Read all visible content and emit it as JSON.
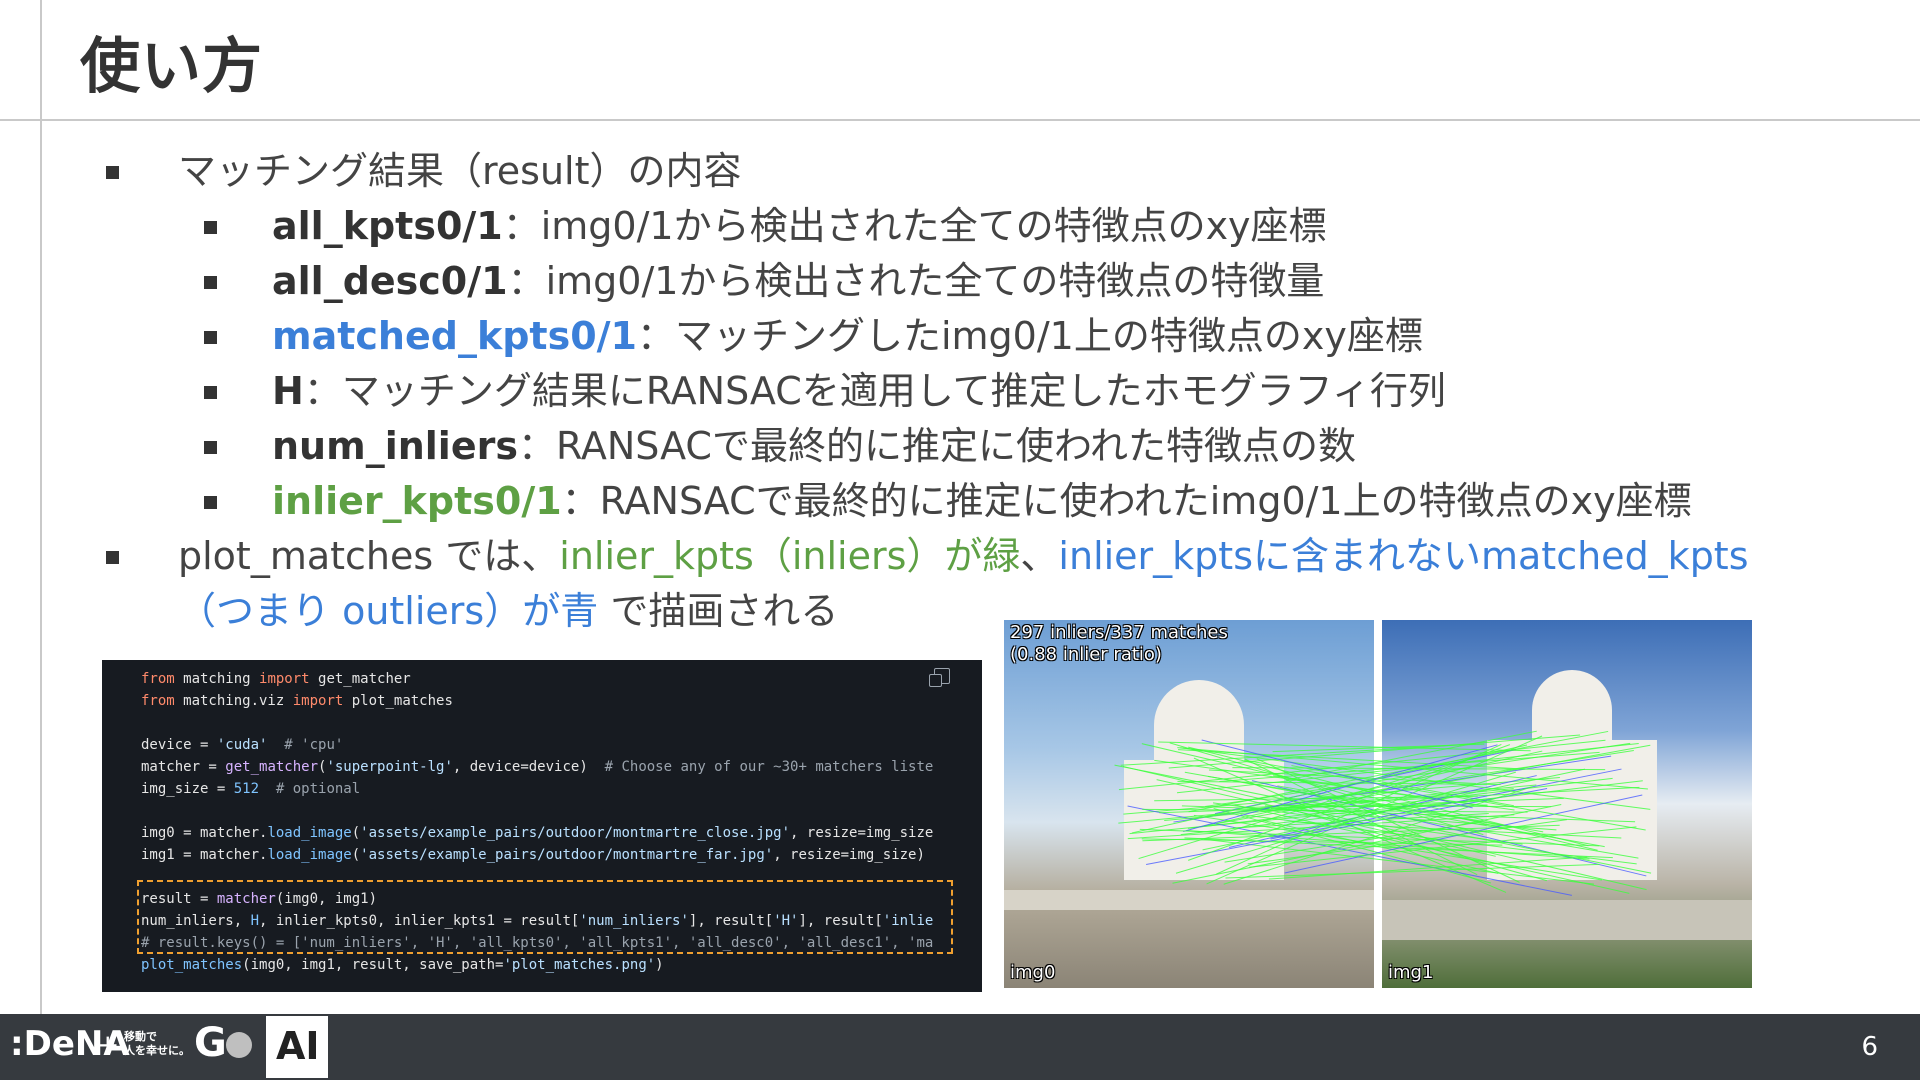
{
  "slide": {
    "title": "使い方",
    "page_number": "6"
  },
  "bullets": {
    "b1": "マッチング結果（result）の内容",
    "sub": [
      {
        "key": "all_kpts0/1",
        "text": "：img0/1から検出された全ての特徴点のxy座標"
      },
      {
        "key": "all_desc0/1",
        "text": "：img0/1から検出された全ての特徴点の特徴量"
      },
      {
        "key": "matched_kpts0/1",
        "text": "：マッチングしたimg0/1上の特徴点のxy座標"
      },
      {
        "key": "H",
        "text": "：マッチング結果にRANSACを適用して推定したホモグラフィ行列"
      },
      {
        "key": "num_inliers",
        "text": "：RANSACで最終的に推定に使われた特徴点の数"
      },
      {
        "key": "inlier_kpts0/1",
        "text": "：RANSACで最終的に推定に使われたimg0/1上の特徴点のxy座標"
      }
    ],
    "b2_prefix": "plot_matches では、",
    "b2_green": "inlier_kpts（inliers）が緑",
    "b2_sep": "、",
    "b2_blue1": "inlier_kptsに含まれないmatched_kpts",
    "b2_blue2": "（つまり outliers）が青",
    "b2_suffix": " で描画される"
  },
  "code": {
    "l1": [
      "from",
      " matching ",
      "import",
      " get_matcher"
    ],
    "l2": [
      "from",
      " matching.viz ",
      "import",
      " plot_matches"
    ],
    "l4": [
      "device = ",
      "'cuda'",
      "  # 'cpu'"
    ],
    "l5": [
      "matcher = ",
      "get_matcher",
      "(",
      "'superpoint-lg'",
      ", device=device)  ",
      "# Choose any of our ~30+ matchers liste"
    ],
    "l6": [
      "img_size = ",
      "512",
      "  # optional"
    ],
    "l8": [
      "img0 = matcher.",
      "load_image",
      "(",
      "'assets/example_pairs/outdoor/montmartre_close.jpg'",
      ", resize=img_size"
    ],
    "l9": [
      "img1 = matcher.",
      "load_image",
      "(",
      "'assets/example_pairs/outdoor/montmartre_far.jpg'",
      ", resize=img_size)"
    ],
    "l11": [
      "result = ",
      "matcher",
      "(img0, img1)"
    ],
    "l12": [
      "num_inliers, ",
      "H",
      ", inlier_kpts0, inlier_kpts1 = result[",
      "'num_inliers'",
      "], result[",
      "'H'",
      "], result[",
      "'inlie"
    ],
    "l13": "# result.keys() = ['num_inliers', 'H', 'all_kpts0', 'all_kpts1', 'all_desc0', 'all_desc1', 'ma",
    "l14": [
      "plot_matches",
      "(img0, img1, result, save_path=",
      "'plot_matches.png'",
      ")"
    ]
  },
  "figure": {
    "caption_line1": "297 inliers/337 matches",
    "caption_line2": "(0.88 inlier ratio)",
    "img0_label": "img0",
    "img1_label": "img1"
  },
  "footer": {
    "dena": ":DeNA",
    "plus": "+",
    "go_text_1": "移動で",
    "go_text_2": "人を幸せに。",
    "go": "G",
    "ai": "AI"
  },
  "colors": {
    "blue": "#3b7fd8",
    "green": "#5ea044",
    "code_bg": "#171b21",
    "footer_bg": "#363a3f",
    "dash": "#f0a030"
  }
}
